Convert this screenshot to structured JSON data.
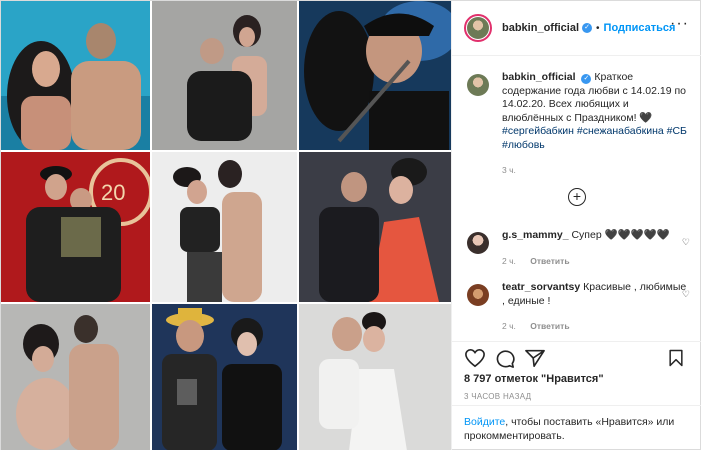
{
  "post": {
    "username": "babkin_official",
    "dot": "•",
    "follow_label": "Подписаться",
    "more_icon": "more-horizontal-icon",
    "caption": {
      "username": "babkin_official",
      "text": "Краткое содержание года любви с 14.02.19 по 14.02.20. Всех любящих и влюблённых с Праздником! 🖤",
      "hashtags": "#сергейбабкин #снежанабабкина #СБ #любовь",
      "time": "3 ч."
    },
    "load_more_icon": "plus-circle-icon",
    "comments": [
      {
        "username": "g.s_mammy_",
        "text": "Супер 🖤🖤🖤🖤🖤",
        "time": "2 ч.",
        "reply": "Ответить"
      },
      {
        "username": "teatr_sorvantsy",
        "text": "Красивые , любимые , единые !",
        "time": "2 ч.",
        "reply": "Ответить"
      }
    ],
    "likes": "8 797 отметок \"Нравится\"",
    "posted": "3 ЧАСОВ НАЗАД",
    "login_link": "Войдите",
    "login_text": ", чтобы поставить «Нравится» или прокомментировать.",
    "colors": {
      "accent": "#0095f6",
      "verified": "#3897f0",
      "link": "#00376b"
    }
  }
}
